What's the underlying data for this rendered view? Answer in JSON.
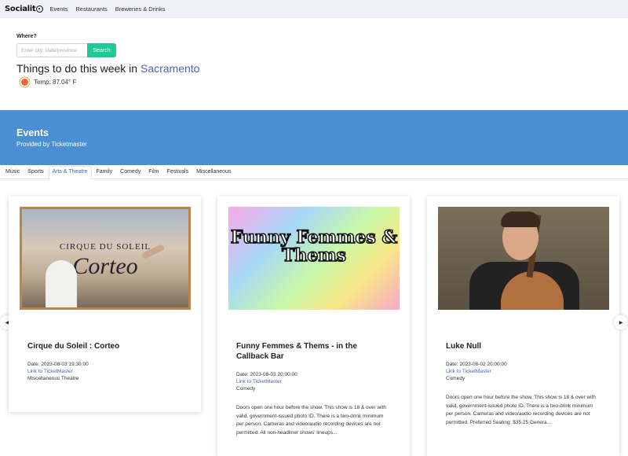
{
  "navbar": {
    "brand": "Socialit",
    "links": [
      "Events",
      "Restaurants",
      "Breweries & Drinks"
    ]
  },
  "hero": {
    "where_label": "Where?",
    "search_placeholder": "Enter city, state/province",
    "search_button": "Search",
    "things_prefix": "Things to do this week in ",
    "city": "Sacramento",
    "temp": "Temp: 87.04° F"
  },
  "events": {
    "title": "Events",
    "subtitle": "Provided by Ticketmaster"
  },
  "tabs": [
    "Music",
    "Sports",
    "Arts & Theatre",
    "Family",
    "Comedy",
    "Film",
    "Festivals",
    "Miscellaneous"
  ],
  "active_tab": "Arts & Theatre",
  "cards": [
    {
      "image_text_top": "CIRQUE DU SOLEIL",
      "image_text_main": "Corteo",
      "title": "Cirque du Soleil : Corteo",
      "date": "Date: 2023-08-03 19:30:00",
      "link": "Link to TicketMaster",
      "genre": "Miscellaneous Theatre",
      "description": ""
    },
    {
      "image_text_main": "Funny Femmes & Thems",
      "title": "Funny Femmes & Thems - in the Callback Bar",
      "date": "Date: 2023-08-03 20:00:00",
      "link": "Link to TicketMaster",
      "genre": "Comedy",
      "description": "Doors open one hour before the show. This show is 18 & over with valid, government-issued photo ID. There is a two-drink minimum per person. Cameras and video/audio recording devices are not permitted. All non-headliner shows' lineups..."
    },
    {
      "title": "Luke Null",
      "date": "Date: 2023-08-02 20:00:00",
      "link": "Link to TicketMaster",
      "genre": "Comedy",
      "description": "Doors open one hour before the show. This show is 18 & over with valid, government-issued photo ID. There is a two-drink minimum per person. Cameras and video/audio recording devices are not permitted. Preferred Seating: $35.25 Genera..."
    }
  ],
  "colors": {
    "accent": "#4a63b8",
    "banner": "#4a8fd4",
    "search_button": "#20c997"
  }
}
